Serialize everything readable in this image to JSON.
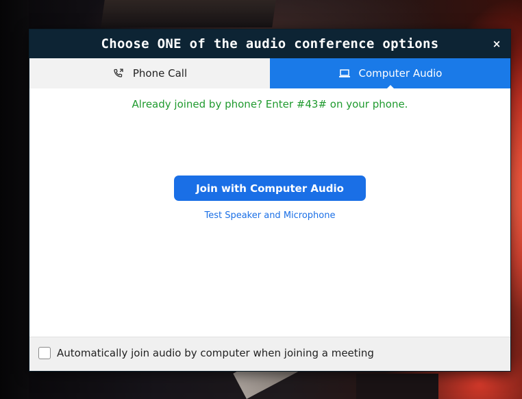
{
  "dialog": {
    "title": "Choose ONE of the audio conference options",
    "close_symbol": "×"
  },
  "tabs": [
    {
      "label": "Phone Call",
      "icon": "phone-icon",
      "active": false
    },
    {
      "label": "Computer Audio",
      "icon": "laptop-icon",
      "active": true
    }
  ],
  "main": {
    "phone_hint": "Already joined by phone? Enter #43# on your phone.",
    "join_button_label": "Join with Computer Audio",
    "test_link_label": "Test Speaker and Microphone"
  },
  "footer": {
    "auto_join_label": "Automatically join audio by computer when joining a meeting",
    "auto_join_checked": false
  },
  "colors": {
    "titlebar": "#0d2434",
    "accent": "#1a7ae8",
    "hint_green": "#1f9a2e"
  }
}
